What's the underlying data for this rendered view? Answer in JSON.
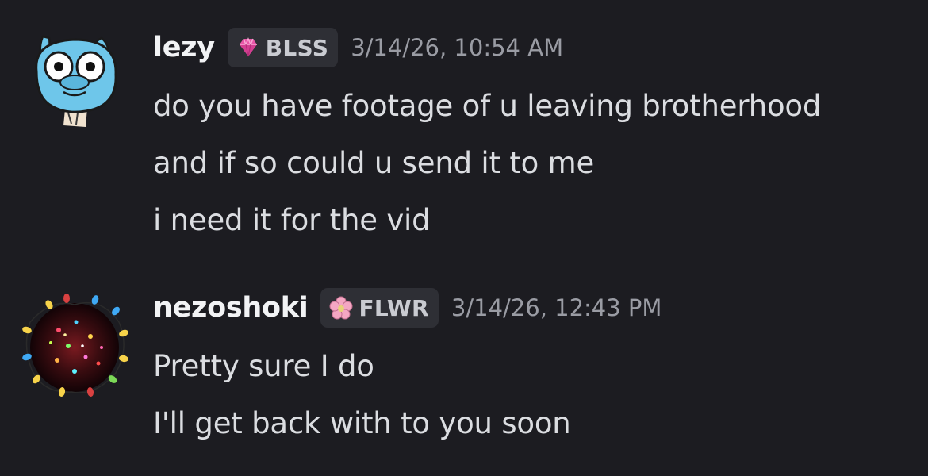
{
  "messages": [
    {
      "author": "lezy",
      "avatar_icon": "gumball-cartoon-avatar",
      "tag": {
        "label": "BLSS",
        "icon": "pink-gem-icon",
        "color": "#e857a8"
      },
      "timestamp": "3/14/26, 10:54 AM",
      "lines": [
        "do you have footage of u leaving brotherhood",
        "and if so could u send it to me",
        "i need it for the vid"
      ]
    },
    {
      "author": "nezoshoki",
      "avatar_icon": "christmas-lights-avatar",
      "tag": {
        "label": "FLWR",
        "icon": "pink-flower-icon",
        "color": "#f4a7c3"
      },
      "timestamp": "3/14/26, 12:43 PM",
      "lines": [
        "Pretty sure I do",
        "I'll get back with to you soon"
      ]
    }
  ],
  "colors": {
    "background": "#1c1c21",
    "username": "#f2f3f5",
    "message_text": "#dbdde1",
    "timestamp": "#9a9ca4",
    "tag_background": "#2e2f35"
  }
}
